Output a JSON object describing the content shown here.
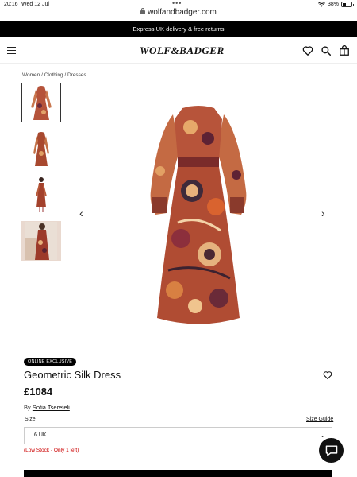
{
  "status": {
    "time": "20:16",
    "date": "Wed 12 Jul",
    "battery": "38%",
    "battery_level": 0.38
  },
  "browser": {
    "url": "wolfandbadger.com"
  },
  "promo": {
    "text": "Express UK delivery & free returns"
  },
  "header": {
    "logo": "WOLF&BADGER"
  },
  "breadcrumb": "Women / Clothing / Dresses",
  "product": {
    "badge": "ONLINE EXCLUSIVE",
    "title": "Geometric Silk Dress",
    "price": "£1084",
    "by_label": "By",
    "designer": "Sofia Tsereteli",
    "size_label": "Size",
    "size_guide": "Size Guide",
    "size_value": "6 UK",
    "stock_note": "(Low Stock - Only 1 left)"
  },
  "colors": {
    "promo_bg": "#000000",
    "stock": "#cc0000",
    "chat_bg": "#111111"
  }
}
